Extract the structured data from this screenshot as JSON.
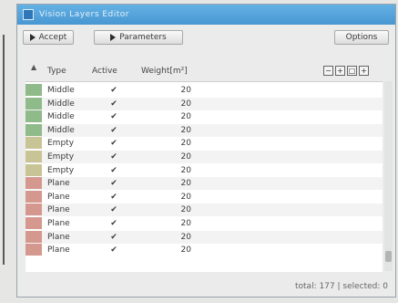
{
  "window": {
    "title": "Vision Layers Editor"
  },
  "toolbar": {
    "accept_label": "Accept",
    "parameters_label": "Parameters",
    "options_label": "Options"
  },
  "columns": {
    "type": "Type",
    "active": "Active",
    "weight": "Weight[m²]"
  },
  "column_tools": [
    "−",
    "+",
    "□",
    "+"
  ],
  "rows": [
    {
      "type": "Middle",
      "active": "✔",
      "weight": "20",
      "group": "green"
    },
    {
      "type": "Middle",
      "active": "✔",
      "weight": "20",
      "group": "green"
    },
    {
      "type": "Middle",
      "active": "✔",
      "weight": "20",
      "group": "green"
    },
    {
      "type": "Middle",
      "active": "✔",
      "weight": "20",
      "group": "green"
    },
    {
      "type": "Empty",
      "active": "✔",
      "weight": "20",
      "group": "mixed"
    },
    {
      "type": "Empty",
      "active": "✔",
      "weight": "20",
      "group": "mixed"
    },
    {
      "type": "Empty",
      "active": "✔",
      "weight": "20",
      "group": "mixed"
    },
    {
      "type": "Plane",
      "active": "✔",
      "weight": "20",
      "group": "red"
    },
    {
      "type": "Plane",
      "active": "✔",
      "weight": "20",
      "group": "red"
    },
    {
      "type": "Plane",
      "active": "✔",
      "weight": "20",
      "group": "red"
    },
    {
      "type": "Plane",
      "active": "✔",
      "weight": "20",
      "group": "red"
    },
    {
      "type": "Plane",
      "active": "✔",
      "weight": "20",
      "group": "red"
    },
    {
      "type": "Plane",
      "active": "✔",
      "weight": "20",
      "group": "red"
    }
  ],
  "row_colors": {
    "green": "#8fba8a",
    "mixed": "#c8c496",
    "red": "#d5988f"
  },
  "status": {
    "text": "total: 177 | selected: 0"
  }
}
